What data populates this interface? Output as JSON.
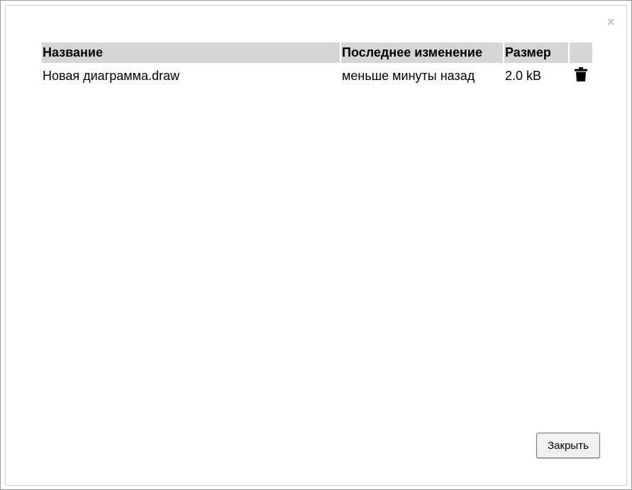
{
  "dialog": {
    "close_glyph": "×",
    "close_button_label": "Закрыть"
  },
  "table": {
    "headers": {
      "name": "Название",
      "modified": "Последнее изменение",
      "size": "Размер"
    },
    "rows": [
      {
        "name": "Новая диаграмма.draw",
        "modified": "меньше минуты назад",
        "size": "2.0 kB",
        "action_icon": "trash-icon"
      }
    ]
  },
  "colors": {
    "header_bg": "#d6d6d6",
    "close_x": "#b8c6d6"
  }
}
